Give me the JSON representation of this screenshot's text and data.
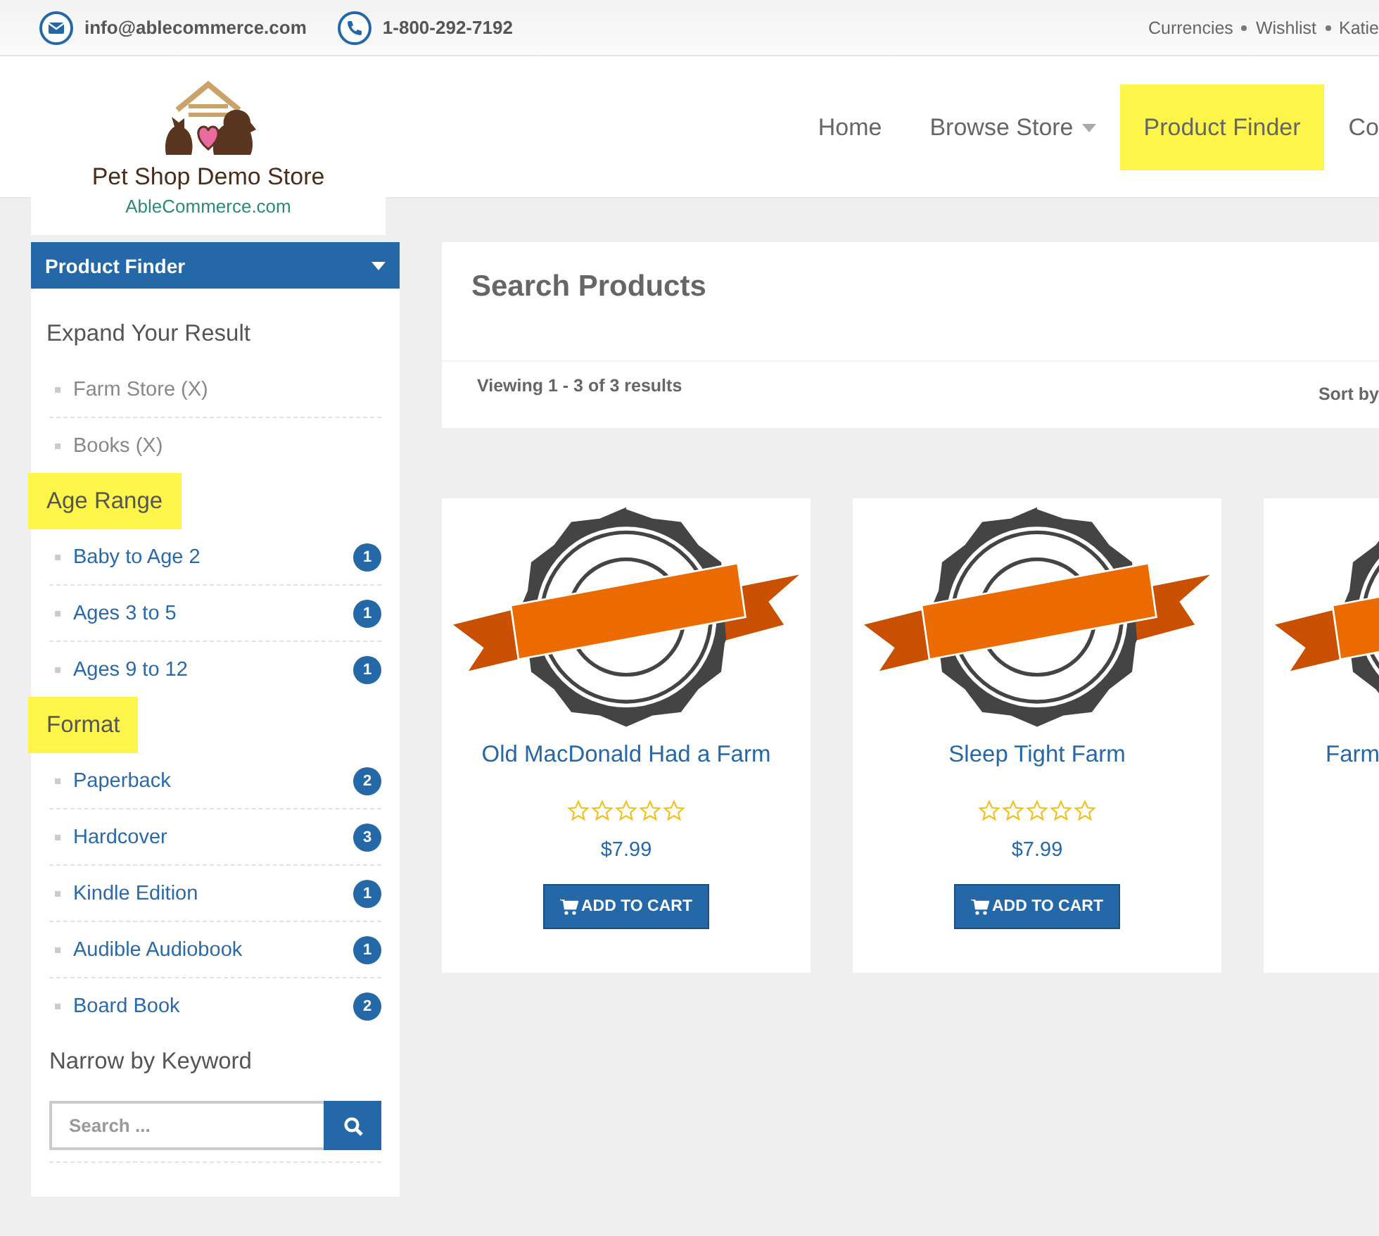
{
  "top_bar": {
    "email": "info@ablecommerce.com",
    "phone": "1-800-292-7192",
    "links": [
      "Currencies",
      "Wishlist",
      "Katie"
    ]
  },
  "logo": {
    "name": "Pet Shop Demo Store",
    "site": "AbleCommerce.com"
  },
  "nav": [
    {
      "label": "Home",
      "highlighted": false,
      "dropdown": false
    },
    {
      "label": "Browse Store",
      "highlighted": false,
      "dropdown": true
    },
    {
      "label": "Product Finder",
      "highlighted": true,
      "dropdown": false
    },
    {
      "label": "Co",
      "highlighted": false,
      "dropdown": false
    }
  ],
  "sidebar": {
    "title": "Product Finder",
    "sections": [
      {
        "heading": "Expand Your Result",
        "highlighted": false,
        "items": [
          {
            "label": "Farm Store (X)",
            "kind": "removable"
          },
          {
            "label": "Books (X)",
            "kind": "removable"
          }
        ]
      },
      {
        "heading": "Age Range",
        "highlighted": true,
        "items": [
          {
            "label": "Baby to Age 2",
            "kind": "filter",
            "count": "1"
          },
          {
            "label": "Ages 3 to 5",
            "kind": "filter",
            "count": "1"
          },
          {
            "label": "Ages 9 to 12",
            "kind": "filter",
            "count": "1"
          }
        ]
      },
      {
        "heading": "Format",
        "highlighted": true,
        "items": [
          {
            "label": "Paperback",
            "kind": "filter",
            "count": "2"
          },
          {
            "label": "Hardcover",
            "kind": "filter",
            "count": "3"
          },
          {
            "label": "Kindle Edition",
            "kind": "filter",
            "count": "1"
          },
          {
            "label": "Audible Audiobook",
            "kind": "filter",
            "count": "1"
          },
          {
            "label": "Board Book",
            "kind": "filter",
            "count": "2"
          }
        ]
      }
    ],
    "keyword_heading": "Narrow by Keyword",
    "search": {
      "placeholder": "Search ..."
    }
  },
  "results": {
    "title": "Search Products",
    "summary": "Viewing 1 - 3 of 3 results",
    "sort_label": "Sort by"
  },
  "products": [
    {
      "name": "Old MacDonald Had a Farm",
      "stars": 0,
      "price": "$7.99",
      "button": "ADD TO CART"
    },
    {
      "name": "Sleep Tight Farm",
      "stars": 0,
      "price": "$7.99",
      "button": "ADD TO CART"
    },
    {
      "name": "Farm"
    }
  ]
}
